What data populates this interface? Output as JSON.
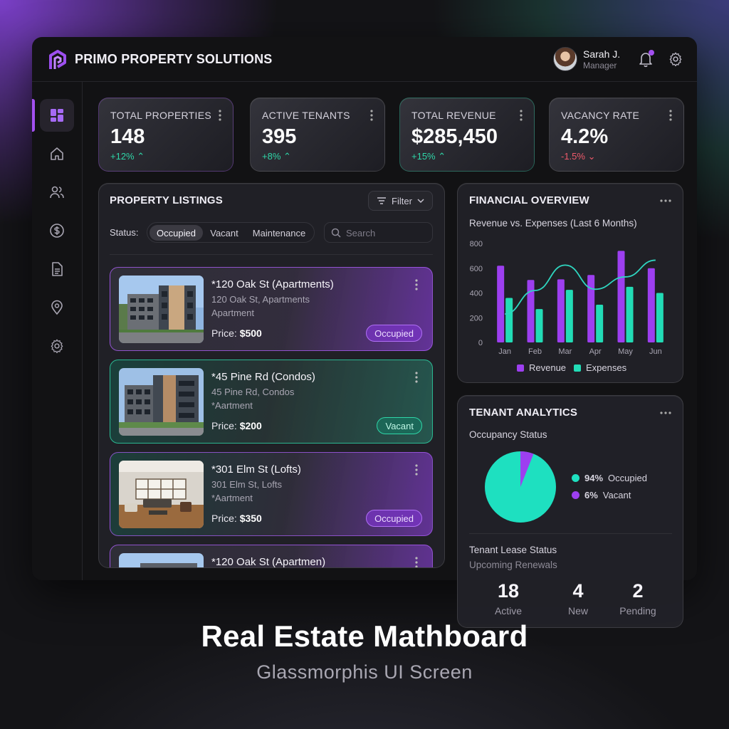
{
  "app": {
    "brand": "PRIMO PROPERTY SOLUTIONS"
  },
  "user": {
    "name": "Sarah J.",
    "role": "Manager"
  },
  "sidebar": {
    "items": [
      "dashboard-icon",
      "home-icon",
      "users-icon",
      "dollar-icon",
      "document-icon",
      "location-pin-icon",
      "settings-icon"
    ]
  },
  "kpis": [
    {
      "title": "TOTAL PROPERTIES",
      "value": "148",
      "delta": "+12%",
      "trend": "up"
    },
    {
      "title": "ACTIVE TENANTS",
      "value": "395",
      "delta": "+8%",
      "trend": "up"
    },
    {
      "title": "TOTAL REVENUE",
      "value": "$285,450",
      "delta": "+15%",
      "trend": "up"
    },
    {
      "title": "VACANCY RATE",
      "value": "4.2%",
      "delta": "-1.5%",
      "trend": "down"
    }
  ],
  "listings_panel": {
    "title": "PROPERTY LISTINGS",
    "filter_label": "Filter",
    "status_label": "Status:",
    "status_options": [
      "Occupied",
      "Vacant",
      "Maintenance"
    ],
    "selected_status": "Occupied",
    "search_placeholder": "Search",
    "price_label": "Price:",
    "items": [
      {
        "title": "*120 Oak St (Apartments)",
        "address": "120 Oak St, Apartments",
        "type": "Apartment",
        "price": "$500",
        "status": "Occupied"
      },
      {
        "title": "*45 Pine Rd (Condos)",
        "address": "45 Pine Rd, Condos",
        "type": "*Aartment",
        "price": "$200",
        "status": "Vacant"
      },
      {
        "title": "*301 Elm St (Lofts)",
        "address": "301 Elm St, Lofts",
        "type": "*Aartment",
        "price": "$350",
        "status": "Occupied"
      },
      {
        "title": "*120 Oak St (Apartmen)"
      }
    ]
  },
  "financial": {
    "title": "FINANCIAL OVERVIEW",
    "subtitle": "Revenue vs. Expenses (Last 6 Months)",
    "colors": {
      "revenue": "#9d3ff0",
      "expenses": "#22dcb6",
      "trend_line": "#2fd6c0"
    }
  },
  "chart_data": {
    "type": "bar",
    "categories": [
      "Jan",
      "Feb",
      "Mar",
      "Apr",
      "May",
      "Jun"
    ],
    "series": [
      {
        "name": "Revenue",
        "values": [
          620,
          505,
          510,
          545,
          740,
          600
        ]
      },
      {
        "name": "Expenses",
        "values": [
          360,
          270,
          425,
          305,
          450,
          400
        ]
      }
    ],
    "trend_line": [
      230,
      420,
      625,
      430,
      530,
      665
    ],
    "ylim": [
      0,
      800
    ],
    "yticks": [
      0,
      200,
      400,
      600,
      800
    ],
    "legend": "bottom"
  },
  "tenants": {
    "title": "TENANT ANALYTICS",
    "occupancy_title": "Occupancy Status",
    "occupied_pct": "94%",
    "occupied_label": "Occupied",
    "vacant_pct": "6%",
    "vacant_label": "Vacant",
    "occupied_fraction": 0.94,
    "lease_title": "Tenant Lease Status",
    "lease_subtitle": "Upcoming Renewals",
    "stats": [
      {
        "value": "18",
        "label": "Active"
      },
      {
        "value": "4",
        "label": "New"
      },
      {
        "value": "2",
        "label": "Pending"
      }
    ]
  },
  "caption": {
    "title": "Real Estate Mathboard",
    "subtitle": "Glassmorphis UI Screen"
  }
}
